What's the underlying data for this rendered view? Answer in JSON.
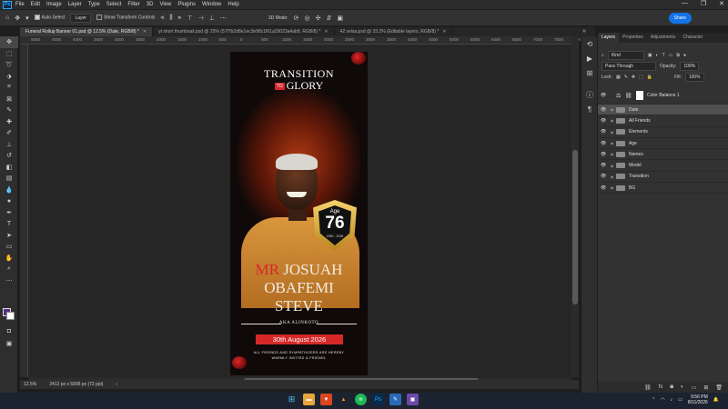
{
  "app": {
    "menu": [
      "File",
      "Edit",
      "Image",
      "Layer",
      "Type",
      "Select",
      "Filter",
      "3D",
      "View",
      "Plugins",
      "Window",
      "Help"
    ],
    "window_controls": [
      "—",
      "❐",
      "✕"
    ]
  },
  "options_bar": {
    "auto_select_label": "Auto-Select",
    "auto_select_target": "Layer",
    "show_transform_label": "Show Transform Controls",
    "mode_3d_label": "3D Mode:",
    "share_label": "Share"
  },
  "tabs": [
    {
      "label": "Funeral Rollup Banner 01.psd @ 12.5% (Date, RGB/8) *",
      "active": true
    },
    {
      "label": "yt short thumbnail.psd @ 25% (57f7b2d8e1ec3e98c1f61a29023a4ab8, RGB/8) *",
      "active": false
    },
    {
      "label": "42 selsa.psd @ 33.3% (Editable layers, RGB/8) *",
      "active": false
    }
  ],
  "ruler_ticks": [
    "5000",
    "4500",
    "4000",
    "3500",
    "3000",
    "2500",
    "2000",
    "1500",
    "1000",
    "500",
    "0",
    "500",
    "1000",
    "1500",
    "2000",
    "2500",
    "3000",
    "3500",
    "4000",
    "4500",
    "5000",
    "5500",
    "6000",
    "6500",
    "7000",
    "7500",
    "8000"
  ],
  "poster": {
    "title_line1": "TRANSITION",
    "title_to": "TO",
    "title_line2": "GLORY",
    "age_label": "Age",
    "age_value": "76",
    "years": "1950 - 2026",
    "name_prefix": "MR",
    "name_line1": "JOSUAH",
    "name_line2": "OBAFEMI",
    "name_line3": "STEVE",
    "alias": "AKA ALINKOTO",
    "date": "30th August 2026",
    "notice_line1": "ALL FRIENDS AND SYMPATHIZERS ARE HEREBY",
    "notice_line2": "WARMLY INVITED & FRIENDL"
  },
  "status_bar": {
    "zoom": "12.5%",
    "doc_size": "2412 px x 5906 px (72 ppi)"
  },
  "layers_panel": {
    "tabs": [
      "Layers",
      "Properties",
      "Adjustments",
      "Character"
    ],
    "filter_kind": "Kind",
    "blend_mode": "Pass Through",
    "opacity_label": "Opacity:",
    "opacity_value": "100%",
    "lock_label": "Lock:",
    "fill_label": "Fill:",
    "fill_value": "100%",
    "layers": [
      {
        "name": "Color Balance 1",
        "type": "adjustment",
        "selected": false
      },
      {
        "name": "Date",
        "type": "group",
        "selected": true
      },
      {
        "name": "All Friends",
        "type": "group",
        "selected": false
      },
      {
        "name": "Elements",
        "type": "group",
        "selected": false
      },
      {
        "name": "Age",
        "type": "group",
        "selected": false
      },
      {
        "name": "Names",
        "type": "group",
        "selected": false
      },
      {
        "name": "Model",
        "type": "group",
        "selected": false
      },
      {
        "name": "Transition",
        "type": "group",
        "selected": false
      },
      {
        "name": "BG",
        "type": "group",
        "selected": false
      }
    ]
  },
  "taskbar": {
    "time": "9:56 PM",
    "date": "8/11/2026"
  },
  "colors": {
    "accent_red": "#d62828",
    "foreground_swatch": "#5b2c83",
    "background_swatch": "#ffffff",
    "share_blue": "#1473e6"
  }
}
